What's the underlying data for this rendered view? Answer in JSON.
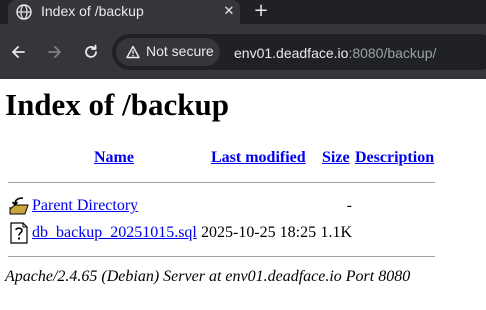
{
  "browser": {
    "tab": {
      "title": "Index of /backup",
      "favicon": "globe-icon",
      "close_icon": "close-icon"
    },
    "new_tab_icon": "plus-icon",
    "nav": {
      "back": "back-arrow-icon",
      "forward": "forward-arrow-icon",
      "reload": "reload-icon"
    },
    "security_chip": {
      "label": "Not secure",
      "icon": "warning-triangle-icon"
    },
    "url": {
      "host": "env01.deadface.io",
      "rest": ":8080/backup/"
    },
    "colors": {
      "chrome_dark": "#202124",
      "chrome": "#35363a",
      "text": "#e8eaed",
      "url_dim": "#9aa0a6"
    }
  },
  "page": {
    "heading": "Index of /backup",
    "columns": {
      "name": "Name",
      "modified": "Last modified",
      "size": "Size",
      "description": "Description"
    },
    "rows": [
      {
        "icon": "back-folder-icon",
        "name": "Parent Directory",
        "modified": "",
        "size": "-",
        "description": ""
      },
      {
        "icon": "unknown-file-icon",
        "name": "db_backup_20251015.sql",
        "modified": "2025-10-25 18:25",
        "size": "1.1K",
        "description": ""
      }
    ],
    "address": "Apache/2.4.65 (Debian) Server at env01.deadface.io Port 8080",
    "colors": {
      "link": "#0000ee",
      "rule": "#a0a0a0"
    }
  }
}
